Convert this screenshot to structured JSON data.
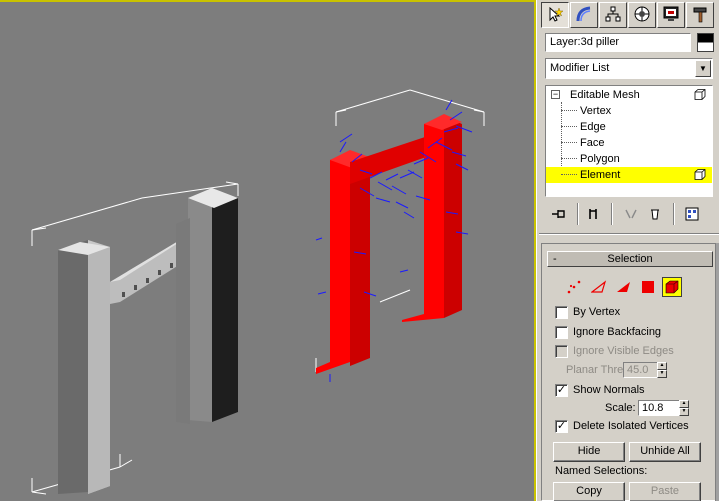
{
  "command_panel": {
    "tabs": [
      {
        "name": "create-tab",
        "icon": "pointer-star-icon",
        "active": true
      },
      {
        "name": "modify-tab",
        "icon": "bend-arc-icon"
      },
      {
        "name": "hierarchy-tab",
        "icon": "hierarchy-icon"
      },
      {
        "name": "motion-tab",
        "icon": "motion-wheel-icon"
      },
      {
        "name": "display-tab",
        "icon": "monitor-icon"
      },
      {
        "name": "utilities-tab",
        "icon": "hammer-icon"
      }
    ],
    "object_name": "Layer:3d piller",
    "modifier_list": "Modifier List",
    "stack": {
      "root": "Editable Mesh",
      "items": [
        "Vertex",
        "Edge",
        "Face",
        "Polygon",
        "Element"
      ],
      "selected": "Element"
    }
  },
  "selection_rollout": {
    "title": "Selection",
    "collapse_symbol": "-",
    "by_vertex": {
      "label": "By Vertex",
      "checked": false
    },
    "ignore_backfacing": {
      "label": "Ignore Backfacing",
      "checked": false
    },
    "ignore_visible_edges": {
      "label": "Ignore Visible Edges",
      "checked": false
    },
    "planar_thresh": {
      "label": "Planar Thresh:",
      "value": "45.0"
    },
    "show_normals": {
      "label": "Show Normals",
      "checked": true,
      "mark": "✓"
    },
    "scale": {
      "label": "Scale:",
      "value": "10.8"
    },
    "delete_isolated": {
      "label": "Delete Isolated Vertices",
      "checked": true,
      "mark": "✓"
    },
    "hide_button": "Hide",
    "unhide_all_button": "Unhide All",
    "named_selections_label": "Named Selections:",
    "copy_button": "Copy",
    "paste_button": "Paste"
  },
  "colors": {
    "viewport_bg": "#7d7d7d",
    "selected_mesh": "#ff0000",
    "normals": "#1a1aff",
    "highlight": "#ffff00",
    "viewport_border": "#c9c200"
  }
}
